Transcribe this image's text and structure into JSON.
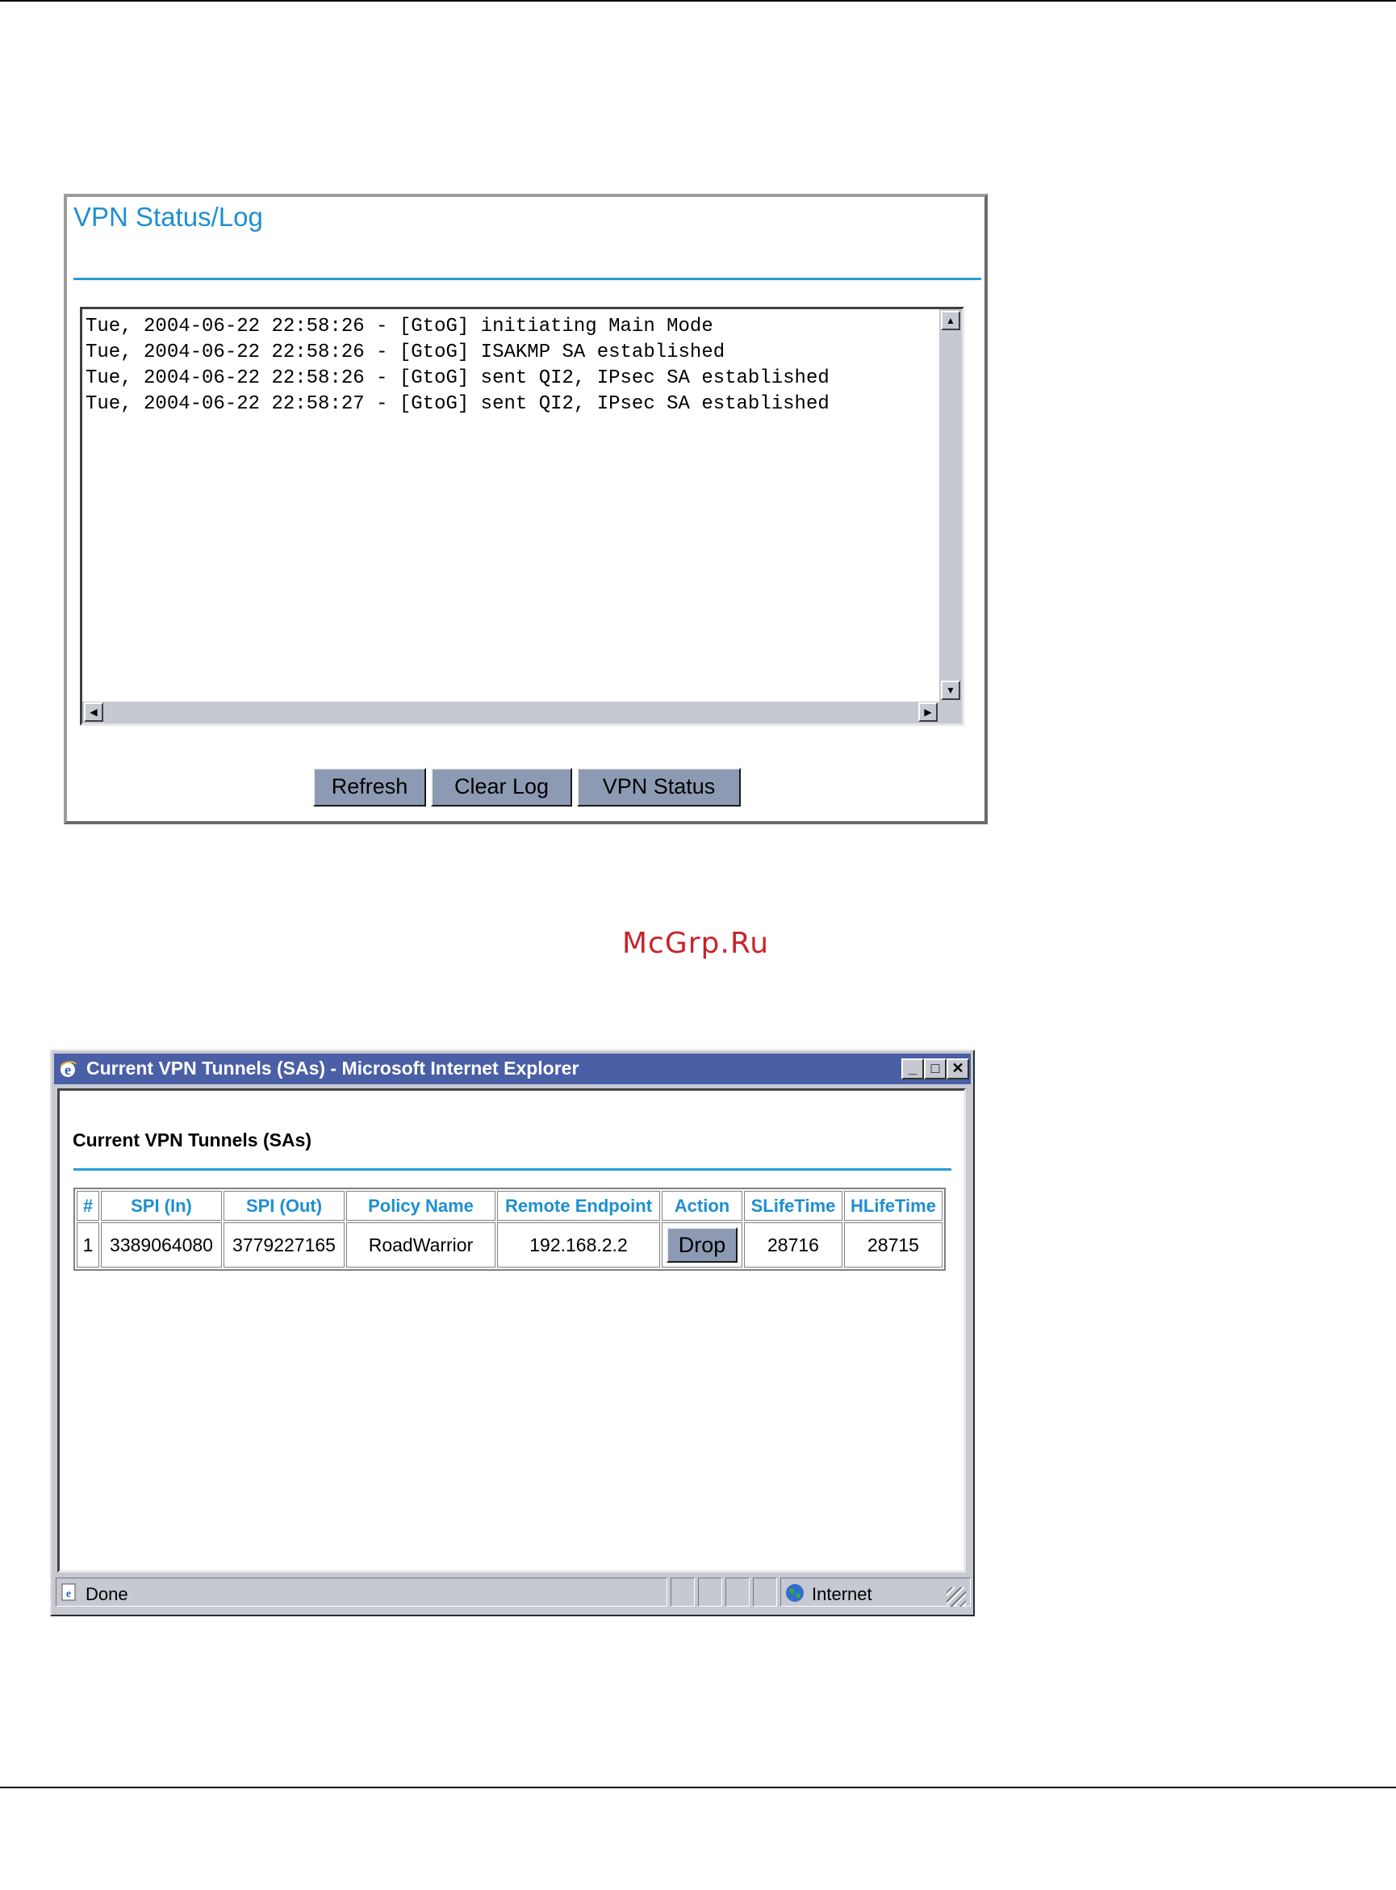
{
  "vpn_log_panel": {
    "title": "VPN Status/Log",
    "log_lines": [
      "Tue, 2004-06-22 22:58:26 - [GtoG] initiating Main Mode",
      "Tue, 2004-06-22 22:58:26 - [GtoG] ISAKMP SA established",
      "Tue, 2004-06-22 22:58:26 - [GtoG] sent QI2, IPsec SA established",
      "Tue, 2004-06-22 22:58:27 - [GtoG] sent QI2, IPsec SA established"
    ],
    "buttons": {
      "refresh": "Refresh",
      "clear_log": "Clear Log",
      "vpn_status": "VPN Status"
    }
  },
  "watermark": "McGrp.Ru",
  "ie_window": {
    "title": "Current VPN Tunnels (SAs) - Microsoft Internet Explorer",
    "page_title": "Current VPN Tunnels (SAs)",
    "table": {
      "headers": [
        "#",
        "SPI (In)",
        "SPI (Out)",
        "Policy Name",
        "Remote Endpoint",
        "Action",
        "SLifeTime",
        "HLifeTime"
      ],
      "rows": [
        {
          "num": "1",
          "spi_in": "3389064080",
          "spi_out": "3779227165",
          "policy_name": "RoadWarrior",
          "remote_endpoint": "192.168.2.2",
          "action": "Drop",
          "slifetime": "28716",
          "hlifetime": "28715"
        }
      ]
    },
    "status_bar": {
      "status": "Done",
      "zone": "Internet"
    }
  },
  "colors": {
    "accent_blue": "#1f8fcf",
    "button_blue": "#8d9ab3",
    "titlebar": "#4a5fa5",
    "watermark_red": "#c8242b"
  }
}
